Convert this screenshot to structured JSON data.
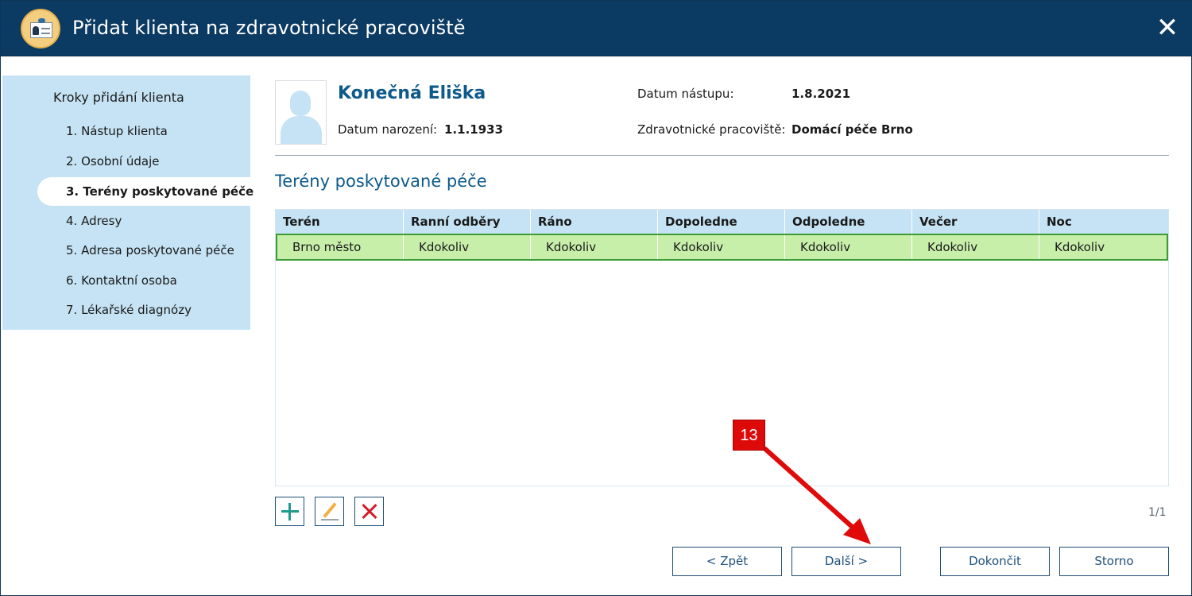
{
  "window": {
    "title": "Přidat klienta na zdravotnické pracoviště",
    "close_icon": "close-icon",
    "accent_color": "#0b3a63"
  },
  "sidebar": {
    "title": "Kroky přidání klienta",
    "steps": [
      {
        "label": "1. Nástup klienta",
        "active": false
      },
      {
        "label": "2. Osobní údaje",
        "active": false
      },
      {
        "label": "3. Terény poskytované péče",
        "active": true
      },
      {
        "label": "4. Adresy",
        "active": false
      },
      {
        "label": "5. Adresa poskytované péče",
        "active": false
      },
      {
        "label": "6. Kontaktní osoba",
        "active": false
      },
      {
        "label": "7. Lékařské diagnózy",
        "active": false
      }
    ]
  },
  "client": {
    "name": "Konečná Eliška",
    "birth_label": "Datum narození:",
    "birth_value": "1.1.1933",
    "start_label": "Datum nástupu:",
    "start_value": "1.8.2021",
    "workplace_label": "Zdravotnické pracoviště:",
    "workplace_value": "Domácí péče Brno"
  },
  "section": {
    "title": "Terény poskytované péče"
  },
  "table": {
    "columns": [
      "Terén",
      "Ranní odběry",
      "Ráno",
      "Dopoledne",
      "Odpoledne",
      "Večer",
      "Noc"
    ],
    "rows": [
      [
        "Brno město",
        "Kdokoliv",
        "Kdokoliv",
        "Kdokoliv",
        "Kdokoliv",
        "Kdokoliv",
        "Kdokoliv"
      ]
    ],
    "selected_row_color": "#c8efaa"
  },
  "toolbar": {
    "add_icon": "plus-icon",
    "edit_icon": "pencil-icon",
    "delete_icon": "delete-x-icon"
  },
  "pager": "1/1",
  "buttons": {
    "back": "< Zpět",
    "next": "Další >",
    "finish": "Dokončit",
    "cancel": "Storno"
  },
  "annotation": {
    "badge": "13",
    "color": "#dd0a0a"
  }
}
